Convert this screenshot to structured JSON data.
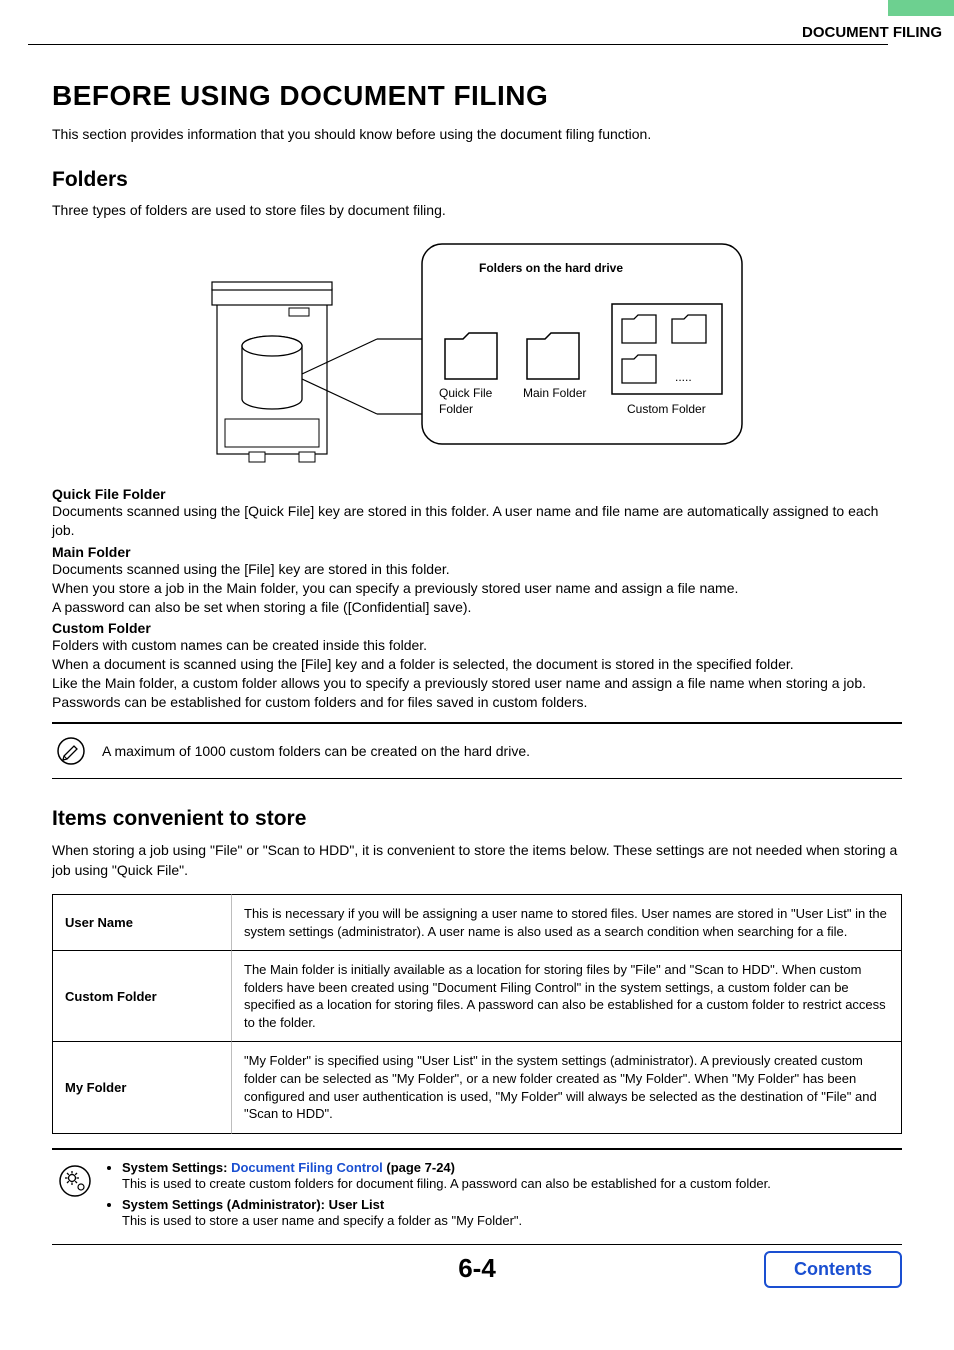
{
  "header": {
    "section": "DOCUMENT FILING"
  },
  "title": "BEFORE USING DOCUMENT FILING",
  "intro": "This section provides information that you should know before using the document filing function.",
  "folders": {
    "heading": "Folders",
    "intro": "Three types of folders are used to store files by document filing.",
    "diagram": {
      "title": "Folders on the hard drive",
      "label1a": "Quick File",
      "label1b": "Folder",
      "label2": "Main Folder",
      "label3": "Custom Folder",
      "dots": "....."
    },
    "items": [
      {
        "term": "Quick File Folder",
        "lines": [
          "Documents scanned using the [Quick File] key are stored in this folder. A user name and file name are automatically assigned to each job."
        ]
      },
      {
        "term": "Main Folder",
        "lines": [
          "Documents scanned using the [File] key are stored in this folder.",
          "When you store a job in the Main folder, you can specify a previously stored user name and assign a file name.",
          "A password can also be set when storing a file ([Confidential] save)."
        ]
      },
      {
        "term": "Custom Folder",
        "lines": [
          "Folders with custom names can be created inside this folder.",
          "When a document is scanned using the [File] key and a folder is selected, the document is stored in the specified folder.",
          "Like the Main folder, a custom folder allows you to specify a previously stored user name and assign a file name when storing a job.",
          "Passwords can be established for custom folders and for files saved in custom folders."
        ]
      }
    ]
  },
  "note": "A maximum of 1000 custom folders can be created on the hard drive.",
  "convenient": {
    "heading": "Items convenient to store",
    "intro": "When storing a job using \"File\" or \"Scan to HDD\", it is convenient to store the items below. These settings are not needed when storing a job using \"Quick File\".",
    "rows": [
      {
        "k": "User Name",
        "v": "This is necessary if you will be assigning a user name to stored files. User names are stored in \"User List\" in the system settings (administrator). A user name is also used as a search condition when searching for a file."
      },
      {
        "k": "Custom Folder",
        "v": "The Main folder is initially available as a location for storing files by \"File\" and \"Scan to HDD\". When custom folders have been created using \"Document Filing Control\" in the system settings, a custom folder can be specified as a location for storing files. A password can also be established for a custom folder to restrict access to the folder."
      },
      {
        "k": "My Folder",
        "v": "\"My Folder\" is specified using \"User List\" in the system settings (administrator). A previously created custom folder can be selected as \"My Folder\", or a new folder created as \"My Folder\". When \"My Folder\" has been configured and user authentication is used, \"My Folder\" will always be selected as the destination of \"File\" and \"Scan to HDD\"."
      }
    ]
  },
  "settings": {
    "items": [
      {
        "lead": "System Settings: ",
        "link": "Document Filing Control",
        "trail": " (page 7-24)",
        "desc": "This is used to create custom folders for document filing. A password can also be established for a custom folder."
      },
      {
        "lead": "System Settings (Administrator): User List",
        "link": "",
        "trail": "",
        "desc": "This is used to store a user name and specify a folder as \"My Folder\"."
      }
    ]
  },
  "pagenum": "6-4",
  "contents_btn": "Contents"
}
